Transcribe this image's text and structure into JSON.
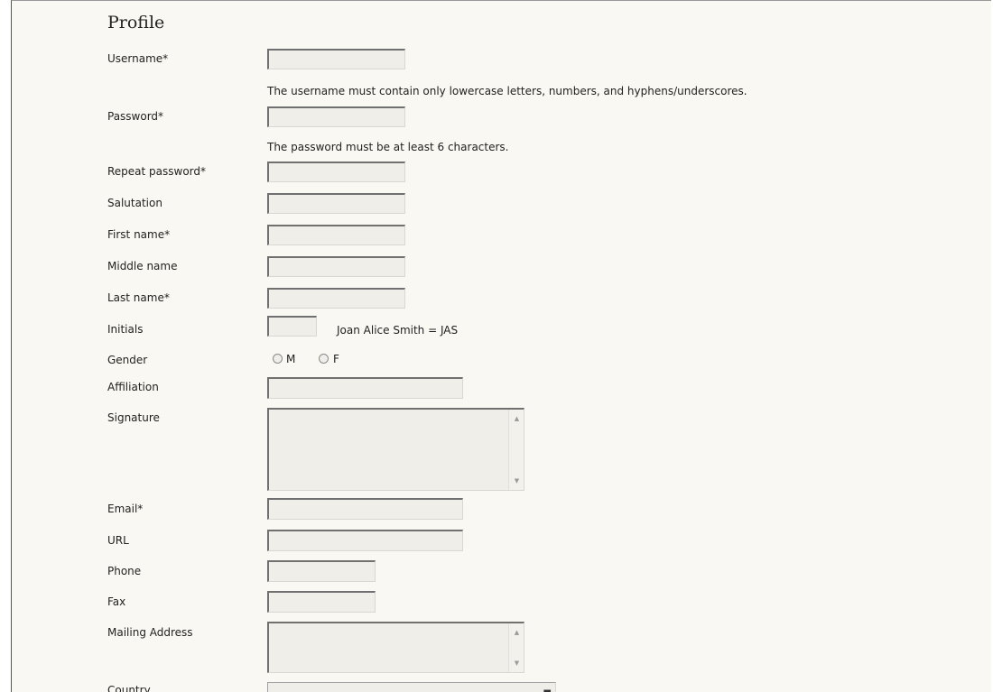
{
  "heading": "Profile",
  "labels": {
    "username": "Username*",
    "password": "Password*",
    "repeat_password": "Repeat password*",
    "salutation": "Salutation",
    "first_name": "First name*",
    "middle_name": "Middle name",
    "last_name": "Last name*",
    "initials": "Initials",
    "gender": "Gender",
    "affiliation": "Affiliation",
    "signature": "Signature",
    "email": "Email*",
    "url": "URL",
    "phone": "Phone",
    "fax": "Fax",
    "mailing_address": "Mailing Address",
    "country": "Country"
  },
  "help": {
    "username": "The username must contain only lowercase letters, numbers, and hyphens/underscores.",
    "password": "The password must be at least 6 characters.",
    "initials_example": "Joan Alice Smith = JAS"
  },
  "gender_options": {
    "male": "M",
    "female": "F"
  },
  "scroll_icons": {
    "up": "▲",
    "down": "▼"
  },
  "select_arrow": "▬"
}
